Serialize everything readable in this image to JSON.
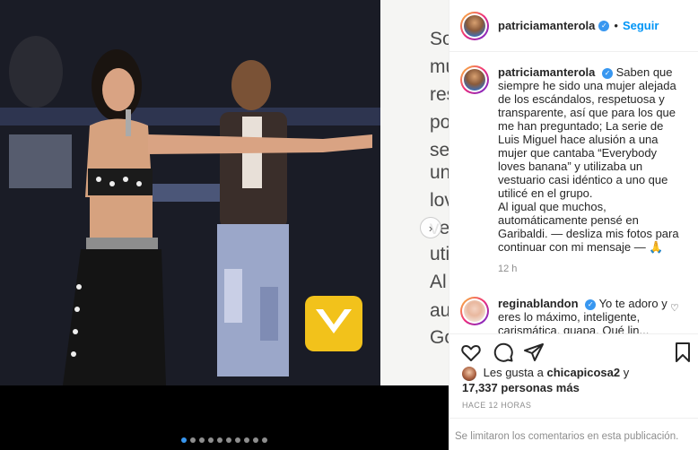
{
  "media": {
    "caption_fragments": [
      "So",
      "mu",
      "res",
      "po",
      "se",
      "un",
      "lov",
      "ve",
      "uti",
      "Al",
      "au",
      "Go"
    ],
    "dot_count": 10,
    "active_dot": 0,
    "next_glyph": "›"
  },
  "header": {
    "username": "patriciamanterola",
    "verified_glyph": "✓",
    "separator": "•",
    "follow_label": "Seguir"
  },
  "caption": {
    "username": "patriciamanterola",
    "text": "Saben que siempre he sido una mujer alejada de los escándalos, respetuosa y transparente, así que para los que me han preguntado; La serie de Luis Miguel hace alusión a una mujer que cantaba “Everybody loves banana” y utilizaba un vestuario casi idéntico a uno que utilicé en el grupo.",
    "text2": "Al igual que muchos, automáticamente pensé en Garibaldi. — desliza mis fotos para continuar con mi mensaje — 🙏",
    "age": "12 h"
  },
  "comment": {
    "username": "reginablandon",
    "text": "Yo te adoro y eres lo máximo, inteligente,",
    "text_cut": "carismática, guapa. Qué lin..."
  },
  "likes": {
    "prefix": "Les gusta a",
    "first_user": "chicapicosa2",
    "conj": "y",
    "count": "17,337 personas más"
  },
  "timestamp": "HACE 12 HORAS",
  "limited_notice": "Se limitaron los comentarios en esta publicación."
}
